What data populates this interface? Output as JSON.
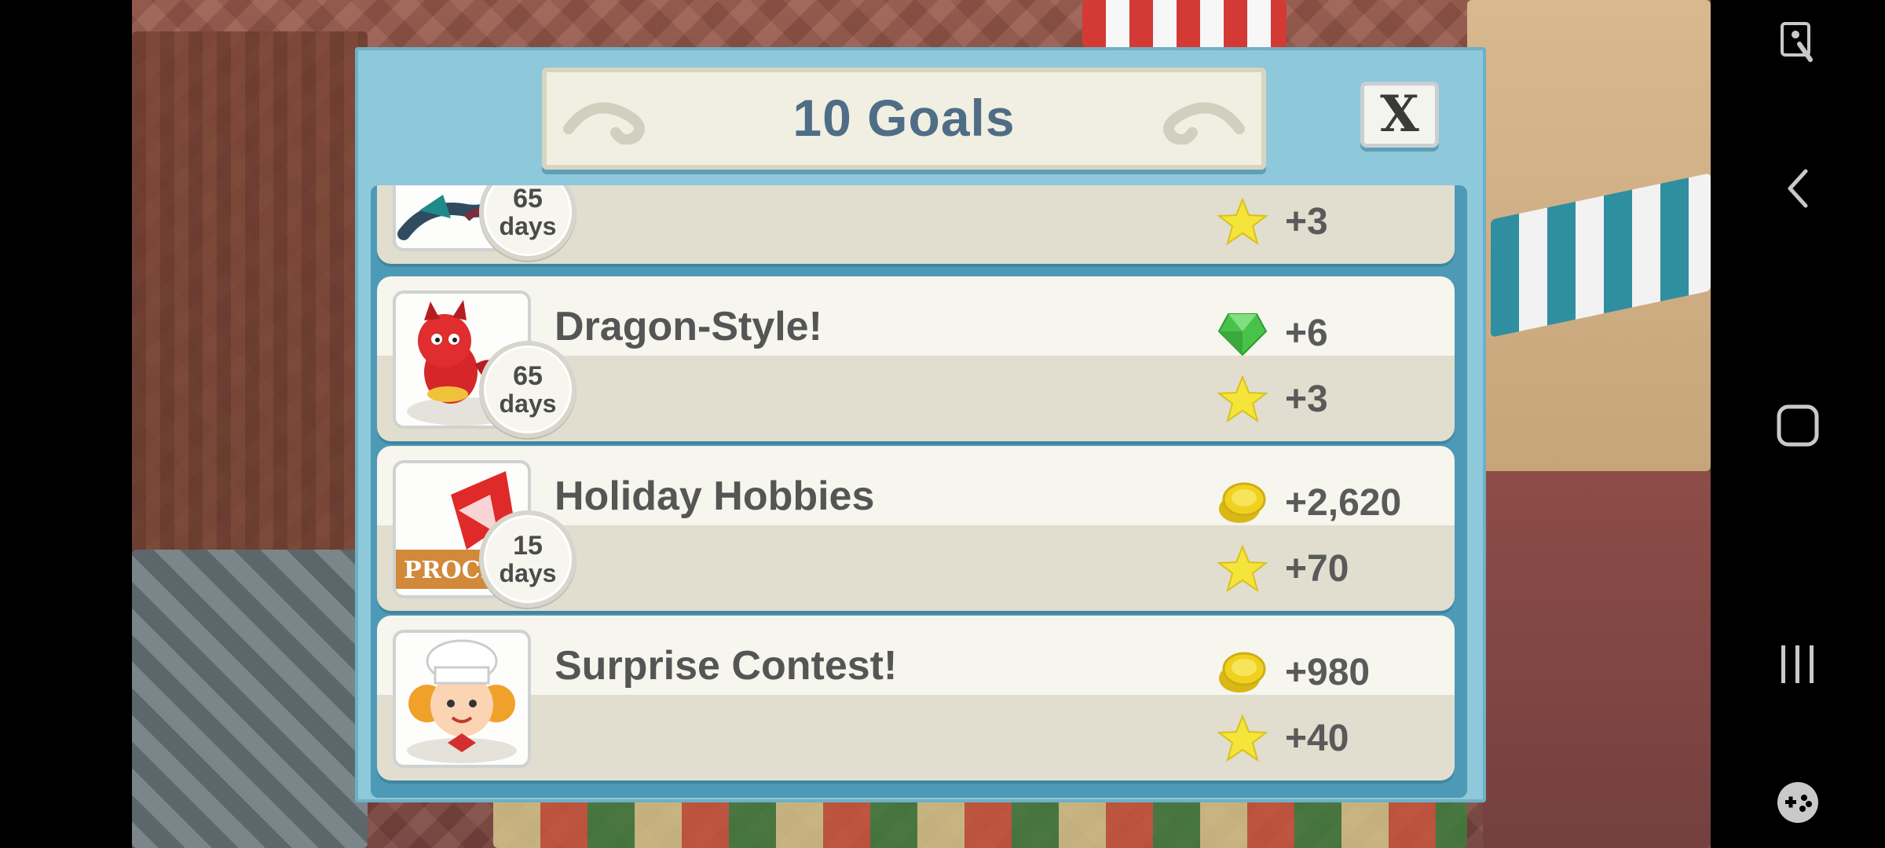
{
  "dialog": {
    "title": "10 Goals",
    "close_label": "X"
  },
  "goals": [
    {
      "name": "",
      "thumbnail": "dragon-tail-thumbnail",
      "timer": {
        "number": "65",
        "unit": "days"
      },
      "rewards": [
        {
          "icon": "star-icon",
          "value": "+3"
        }
      ]
    },
    {
      "name": "Dragon-Style!",
      "thumbnail": "red-dragon-thumbnail",
      "timer": {
        "number": "65",
        "unit": "days"
      },
      "rewards": [
        {
          "icon": "gem-icon",
          "value": "+6"
        },
        {
          "icon": "star-icon",
          "value": "+3"
        }
      ]
    },
    {
      "name": "Holiday Hobbies",
      "thumbnail": "procrastination-sign-thumbnail",
      "thumbnail_text": "PROCR",
      "timer": {
        "number": "15",
        "unit": "days"
      },
      "rewards": [
        {
          "icon": "coin-icon",
          "value": "+2,620"
        },
        {
          "icon": "star-icon",
          "value": "+70"
        }
      ]
    },
    {
      "name": "Surprise Contest!",
      "thumbnail": "chef-girl-thumbnail",
      "rewards": [
        {
          "icon": "coin-icon",
          "value": "+980"
        },
        {
          "icon": "star-icon",
          "value": "+40"
        }
      ]
    }
  ],
  "colors": {
    "dialog_bg": "#8ec8db",
    "title_text": "#4f6d86",
    "row_bg": "#f6f5ee",
    "star": "#f5e43a",
    "coin": "#f0d21e",
    "gem": "#49c24a"
  },
  "navbar": {
    "icons": [
      "accessibility-icon",
      "back-icon",
      "home-icon",
      "recents-icon",
      "game-tools-icon"
    ]
  }
}
